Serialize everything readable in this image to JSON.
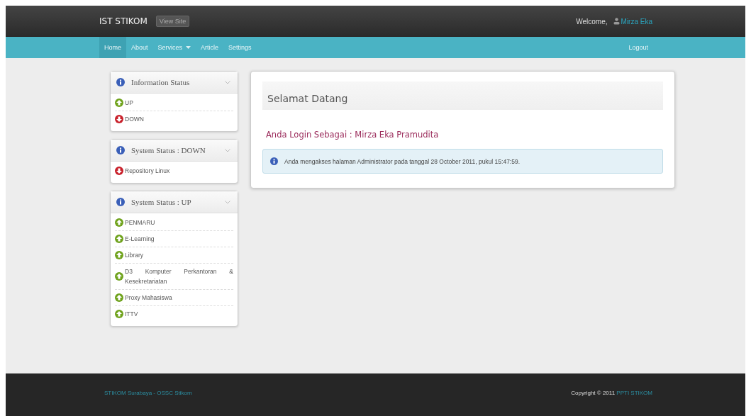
{
  "header": {
    "brand": "IST STIKOM",
    "view_site": "View Site",
    "welcome": "Welcome,",
    "user": "Mirza Eka"
  },
  "nav": {
    "items": [
      {
        "label": "Home",
        "selected": true,
        "dropdown": false
      },
      {
        "label": "About",
        "selected": false,
        "dropdown": false
      },
      {
        "label": "Services",
        "selected": false,
        "dropdown": true
      },
      {
        "label": "Article",
        "selected": false,
        "dropdown": false
      },
      {
        "label": "Settings",
        "selected": false,
        "dropdown": false
      }
    ],
    "logout": "Logout"
  },
  "sidebar": {
    "panels": [
      {
        "title": "Information Status",
        "items": [
          {
            "label": "UP",
            "kind": "up"
          },
          {
            "label": "DOWN",
            "kind": "down"
          }
        ]
      },
      {
        "title": "System Status : DOWN",
        "items": [
          {
            "label": "Repository Linux",
            "kind": "down"
          }
        ]
      },
      {
        "title": "System Status : UP",
        "items": [
          {
            "label": "PENMARU",
            "kind": "up"
          },
          {
            "label": "E-Learning",
            "kind": "up"
          },
          {
            "label": "Library",
            "kind": "up"
          },
          {
            "label": "D3 Komputer Perkantoran & Kesekretariatan",
            "kind": "up"
          },
          {
            "label": "Proxy Mahasiswa",
            "kind": "up"
          },
          {
            "label": "ITTV",
            "kind": "up"
          }
        ]
      }
    ]
  },
  "content": {
    "title": "Selamat Datang",
    "login_line": "Anda Login Sebagai : Mirza Eka Pramudita",
    "info": "Anda mengakses halaman Administrator pada tanggal 28 October 2011, pukul 15:47:59."
  },
  "footer": {
    "left_link": "STIKOM Surabaya - OSSC Stikom",
    "copyright": "Copyright © 2011",
    "copyright_link": "PPTI STIKOM"
  }
}
